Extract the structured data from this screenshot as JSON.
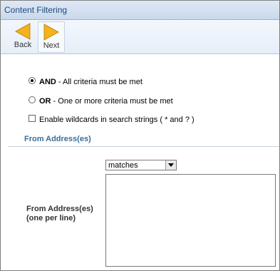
{
  "window": {
    "title": "Content Filtering"
  },
  "toolbar": {
    "back_label": "Back",
    "next_label": "Next"
  },
  "criteria": {
    "and_keyword": "AND",
    "and_desc": " - All criteria must be met",
    "or_keyword": "OR",
    "or_desc": " - One or more criteria must be met",
    "selected": "AND",
    "wildcards_label": "Enable wildcards in search strings ( * and ? )",
    "wildcards_checked": false
  },
  "from_section": {
    "title": "From Address(es)",
    "match_select_value": "matches",
    "addresses_label_line1": "From Address(es)",
    "addresses_label_line2": "(one per line)",
    "addresses_value": ""
  },
  "colors": {
    "title_text": "#1d4a7a",
    "section_title": "#3a6e9a",
    "arrow_fill": "#f5b21f"
  }
}
